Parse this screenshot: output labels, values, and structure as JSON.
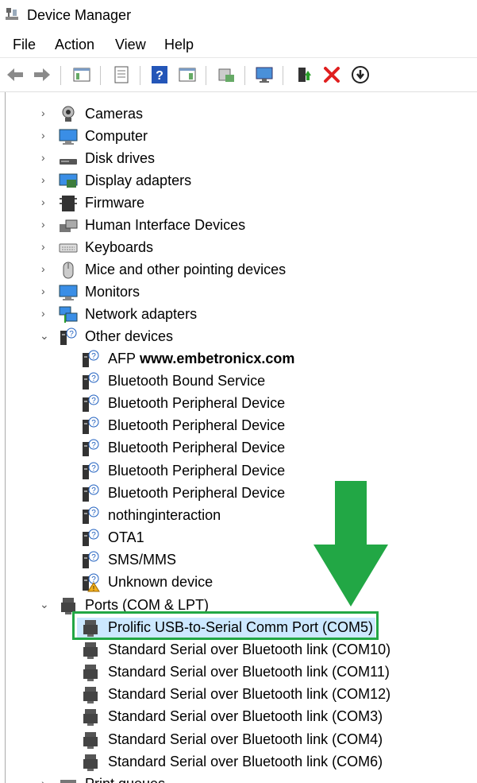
{
  "window": {
    "title": "Device Manager"
  },
  "menu": [
    "File",
    "Action",
    "View",
    "Help"
  ],
  "toolbar": [
    "back-arrow-icon",
    "forward-arrow-icon",
    "show-hide-console-tree-icon",
    "properties-icon",
    "help-icon",
    "action-pane-icon",
    "update-driver-icon",
    "scan-hardware-icon",
    "enable-device-icon",
    "uninstall-icon",
    "download-icon"
  ],
  "tree": {
    "categories": [
      {
        "label": "Cameras",
        "icon": "camera-icon",
        "expanded": false
      },
      {
        "label": "Computer",
        "icon": "computer-icon",
        "expanded": false
      },
      {
        "label": "Disk drives",
        "icon": "disk-drive-icon",
        "expanded": false
      },
      {
        "label": "Display adapters",
        "icon": "display-adapter-icon",
        "expanded": false
      },
      {
        "label": "Firmware",
        "icon": "firmware-icon",
        "expanded": false
      },
      {
        "label": "Human Interface Devices",
        "icon": "hid-icon",
        "expanded": false
      },
      {
        "label": "Keyboards",
        "icon": "keyboard-icon",
        "expanded": false
      },
      {
        "label": "Mice and other pointing devices",
        "icon": "mouse-icon",
        "expanded": false
      },
      {
        "label": "Monitors",
        "icon": "monitor-icon",
        "expanded": false
      },
      {
        "label": "Network adapters",
        "icon": "network-adapter-icon",
        "expanded": false
      },
      {
        "label": "Other devices",
        "icon": "unknown-device-icon",
        "expanded": true
      },
      {
        "label": "Ports (COM & LPT)",
        "icon": "port-icon",
        "expanded": true
      },
      {
        "label": "Print queues",
        "icon": "printer-icon",
        "expanded": false
      }
    ],
    "other_devices": [
      "AFP",
      "Bluetooth Bound Service",
      "Bluetooth Peripheral Device",
      "Bluetooth Peripheral Device",
      "Bluetooth Peripheral Device",
      "Bluetooth Peripheral Device",
      "Bluetooth Peripheral Device",
      "nothinginteraction",
      "OTA1",
      "SMS/MMS",
      "Unknown device"
    ],
    "ports": [
      "Prolific USB-to-Serial Comm Port (COM5)",
      "Standard Serial over Bluetooth link (COM10)",
      "Standard Serial over Bluetooth link (COM11)",
      "Standard Serial over Bluetooth link (COM12)",
      "Standard Serial over Bluetooth link (COM3)",
      "Standard Serial over Bluetooth link (COM4)",
      "Standard Serial over Bluetooth link (COM6)"
    ]
  },
  "watermark": "www.embetronicx.com",
  "colors": {
    "highlight": "#22a745",
    "selection": "#cce8ff"
  }
}
